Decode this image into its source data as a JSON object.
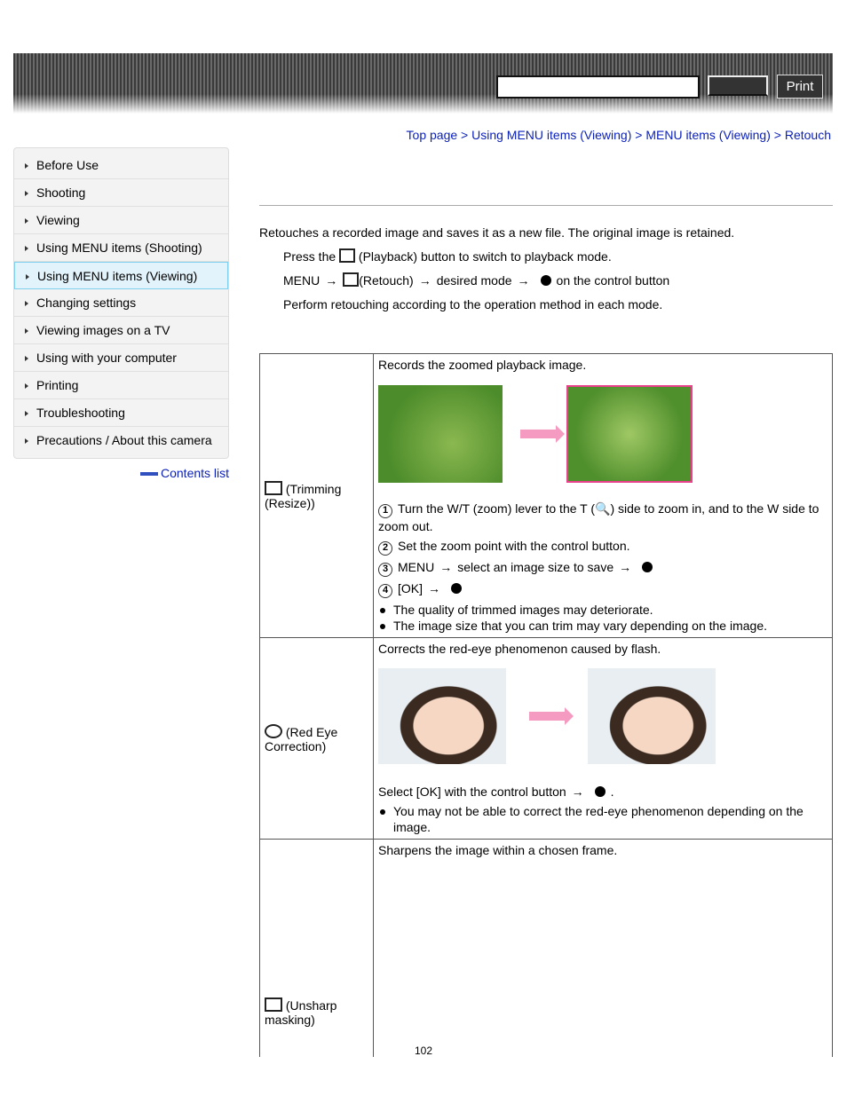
{
  "header": {
    "search_placeholder": "",
    "go_label": "",
    "print_label": "Print"
  },
  "breadcrumb": [
    "Top page",
    "Using MENU items (Viewing)",
    "MENU items (Viewing)",
    "Retouch"
  ],
  "sidebar": {
    "items": [
      {
        "label": "Before Use"
      },
      {
        "label": "Shooting"
      },
      {
        "label": "Viewing"
      },
      {
        "label": "Using MENU items (Shooting)"
      },
      {
        "label": "Using MENU items (Viewing)",
        "active": true
      },
      {
        "label": "Changing settings"
      },
      {
        "label": "Viewing images on a TV"
      },
      {
        "label": "Using with your computer"
      },
      {
        "label": "Printing"
      },
      {
        "label": "Troubleshooting"
      },
      {
        "label": "Precautions / About this camera"
      }
    ],
    "contents_link": "Contents list"
  },
  "intro": {
    "text": "Retouches a recorded image and saves it as a new file. The original image is retained.",
    "step1a": "Press the",
    "step1b": "(Playback) button to switch to playback mode.",
    "step2_menu": "MENU",
    "step2_retouch": "(Retouch)",
    "step2_mode": "desired mode",
    "step2_end": "on the control button",
    "step3": "Perform retouching according to the operation method in each mode.",
    "arrow": "→"
  },
  "modes": [
    {
      "name": "(Trimming (Resize))",
      "icon": "trimming-icon",
      "desc": "Records the zoomed playback image.",
      "steps": [
        "Turn the W/T (zoom) lever to the T (",
        ") side to zoom in, and to the W side to zoom out.",
        "Set the zoom point with the control button.",
        "MENU",
        "select an image size to save",
        "[OK]"
      ],
      "notes": [
        "The quality of trimmed images may deteriorate.",
        "The image size that you can trim may vary depending on the image."
      ]
    },
    {
      "name": "(Red Eye Correction)",
      "icon": "red-eye-icon",
      "desc": "Corrects the red-eye phenomenon caused by flash.",
      "select": "Select [OK] with the control button",
      "period": ".",
      "notes": [
        "You may not be able to correct the red-eye phenomenon depending on the image."
      ]
    },
    {
      "name": "(Unsharp masking)",
      "icon": "unsharp-icon",
      "desc": "Sharpens the image within a chosen frame."
    }
  ],
  "page_number": "102",
  "colors": {
    "link": "#0a1fb8",
    "highlight": "#e8408a"
  }
}
